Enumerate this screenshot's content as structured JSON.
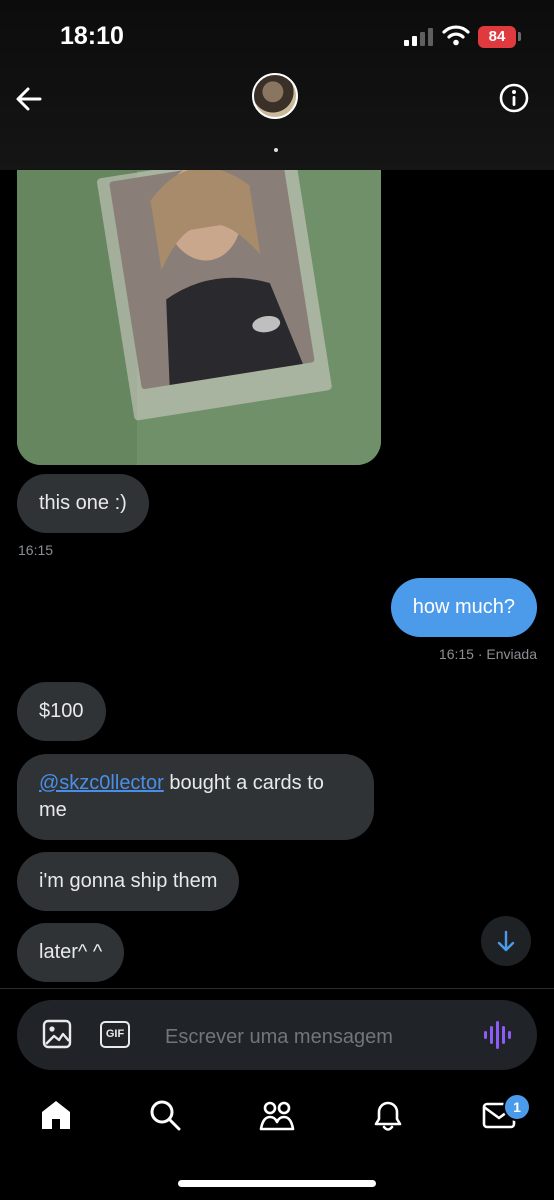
{
  "status_bar": {
    "time": "18:10",
    "battery": "84"
  },
  "messages": [
    {
      "text": "this one :)",
      "time": "16:15"
    },
    {
      "text": "how much?",
      "time": "16:15 · Enviada"
    },
    {
      "text": "$100"
    },
    {
      "mention": "@skzc0llector",
      "text": " bought a cards to me"
    },
    {
      "text": "i'm gonna ship them"
    },
    {
      "text": "later^ ^"
    }
  ],
  "composer": {
    "placeholder": "Escrever uma mensagem",
    "gif_label": "GIF"
  },
  "tabbar": {
    "messages_badge": "1"
  },
  "colors": {
    "outgoing_bubble": "#4c9bea",
    "incoming_bubble": "#2f3336",
    "voice_accent": "#8b5cf6"
  }
}
